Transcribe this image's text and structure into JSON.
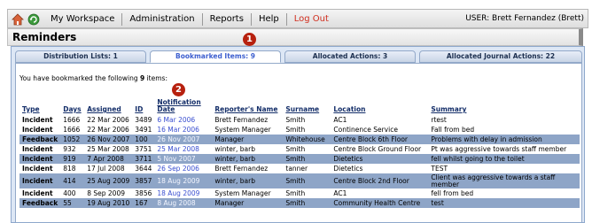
{
  "nav": {
    "items": [
      "My Workspace",
      "Administration",
      "Reports",
      "Help",
      "Log Out"
    ],
    "user": "USER: Brett Fernandez (Brett)"
  },
  "page_title": "Reminders",
  "markers": [
    "1",
    "2"
  ],
  "tabs": [
    "Distribution Lists: 1",
    "Bookmarked Items: 9",
    "Allocated Actions: 3",
    "Allocated Journal Actions: 22"
  ],
  "intro": {
    "prefix": "You have bookmarked the following ",
    "count": "9",
    "suffix": " items:"
  },
  "columns": {
    "type": "Type",
    "days": "Days",
    "assigned": "Assigned",
    "id": "ID",
    "notification": "Notification Date",
    "reporter": "Reporter's Name",
    "surname": "Surname",
    "location": "Location",
    "summary": "Summary"
  },
  "rows": [
    {
      "type": "Incident",
      "days": "1666",
      "assigned": "22 Mar 2006",
      "id": "3489",
      "notification": "6 Mar 2006",
      "reporter": "Brett Fernandez",
      "surname": "Smith",
      "location": "AC1",
      "summary": "rtest"
    },
    {
      "type": "Incident",
      "days": "1666",
      "assigned": "22 Mar 2006",
      "id": "3491",
      "notification": "16 Mar 2006",
      "reporter": "System Manager",
      "surname": "Smith",
      "location": "Continence Service",
      "summary": "Fall from bed"
    },
    {
      "type": "Feedback",
      "days": "1052",
      "assigned": "26 Nov 2007",
      "id": "100",
      "notification": "26 Nov 2007",
      "reporter": "Manager",
      "surname": "Whitehouse",
      "location": "Centre Block 6th Floor",
      "summary": "Problems with delay in admission"
    },
    {
      "type": "Incident",
      "days": "932",
      "assigned": "25 Mar 2008",
      "id": "3751",
      "notification": "25 Mar 2008",
      "reporter": "winter, barb",
      "surname": "Smith",
      "location": "Centre Block Ground Floor",
      "summary": "Pt was aggressive towards staff member"
    },
    {
      "type": "Incident",
      "days": "919",
      "assigned": "7 Apr 2008",
      "id": "3711",
      "notification": "5 Nov 2007",
      "reporter": "winter, barb",
      "surname": "Smith",
      "location": "Dietetics",
      "summary": "fell whilst going to the toilet"
    },
    {
      "type": "Incident",
      "days": "818",
      "assigned": "17 Jul 2008",
      "id": "3644",
      "notification": "26 Sep 2006",
      "reporter": "Brett Fernandez",
      "surname": "tanner",
      "location": "Dietetics",
      "summary": "TEST"
    },
    {
      "type": "Incident",
      "days": "414",
      "assigned": "25 Aug 2009",
      "id": "3857",
      "notification": "18 Aug 2009",
      "reporter": "winter, barb",
      "surname": "Smith",
      "location": "Centre Block 2nd Floor",
      "summary": "Client was aggressive towards a staff member"
    },
    {
      "type": "Incident",
      "days": "400",
      "assigned": "8 Sep 2009",
      "id": "3856",
      "notification": "18 Aug 2009",
      "reporter": "System Manager",
      "surname": "Smith",
      "location": "AC1",
      "summary": "fell from bed"
    },
    {
      "type": "Feedback",
      "days": "55",
      "assigned": "19 Aug 2010",
      "id": "167",
      "notification": "8 Aug 2008",
      "reporter": "Manager",
      "surname": "Smith",
      "location": "Community Health Centre",
      "summary": "test"
    }
  ],
  "colors": {
    "accent": "#3d5fcf",
    "row_alt": "#8ea5c7",
    "logout": "#d12e1e",
    "marker": "#b7210f"
  }
}
